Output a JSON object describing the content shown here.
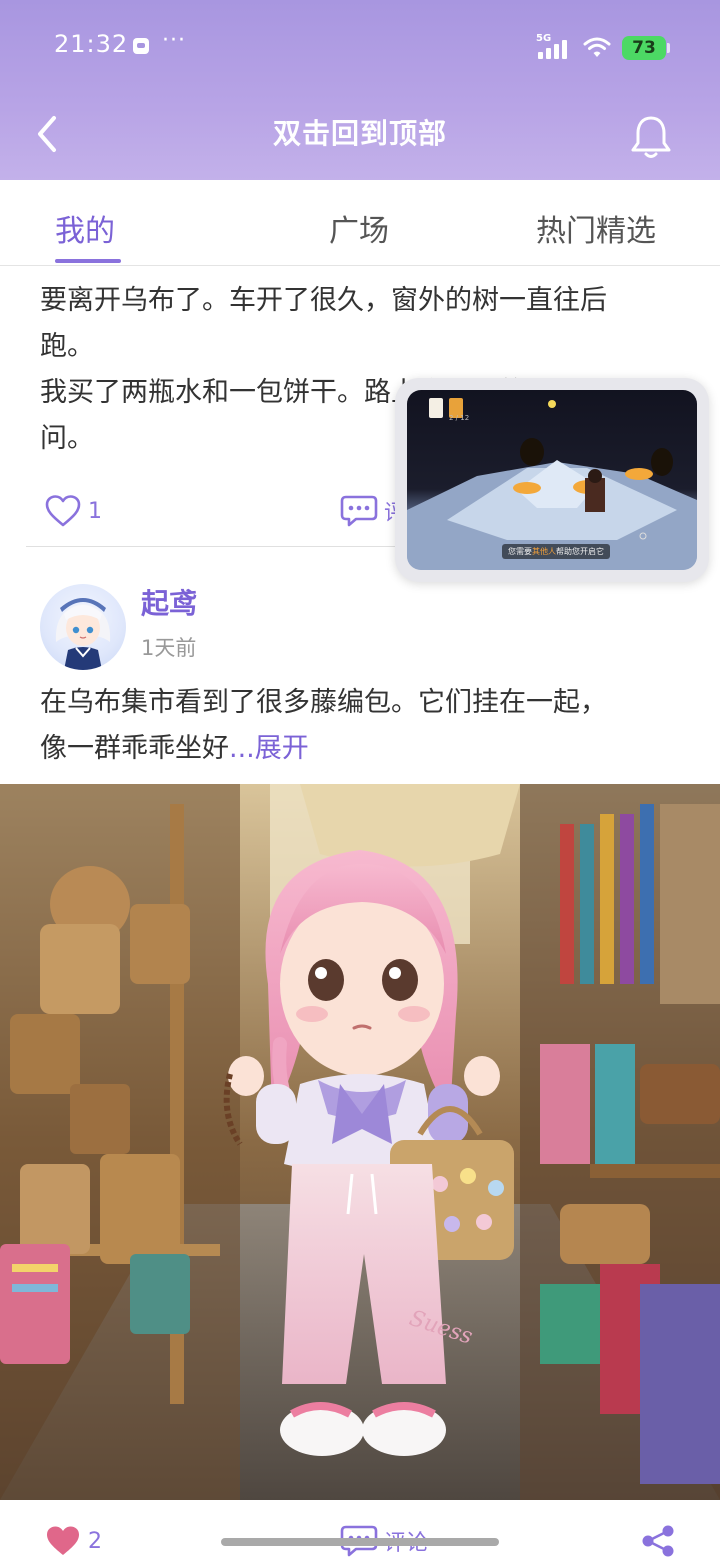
{
  "status_bar": {
    "time": "21:32",
    "dots": "···",
    "network": "5G",
    "battery": "73"
  },
  "nav": {
    "title": "双击回到顶部"
  },
  "tabs": [
    {
      "label": "我的",
      "active": true
    },
    {
      "label": "广场",
      "active": false
    },
    {
      "label": "热门精选",
      "active": false
    }
  ],
  "post1": {
    "text_line1": "要离开乌布了。车开了很久，窗外的树一直往后",
    "text_line2": "跑。",
    "text_line3": "我买了两瓶水和一包饼干。路上会用到的，别",
    "text_line4": "问。",
    "like_count": "1",
    "comment_label": "评论"
  },
  "pip": {
    "caption_prefix": "您需要",
    "caption_highlight": "其他人",
    "caption_suffix": "帮助您开启它",
    "level_text": "2 / 12"
  },
  "post2": {
    "author": "起鸢",
    "time": "1天前",
    "text_line1": "在乌布集市看到了很多藤编包。它们挂在一起，",
    "text_line2": "像一群乖乖坐好",
    "expand": "...展开",
    "image_alt": "bamboo market stall",
    "bag_text": "Suess",
    "like_count": "2",
    "comment_label": "评论"
  },
  "colors": {
    "accent": "#8a72dd",
    "header_gradient_top": "#a896e0",
    "liked_heart": "#e0678a"
  }
}
